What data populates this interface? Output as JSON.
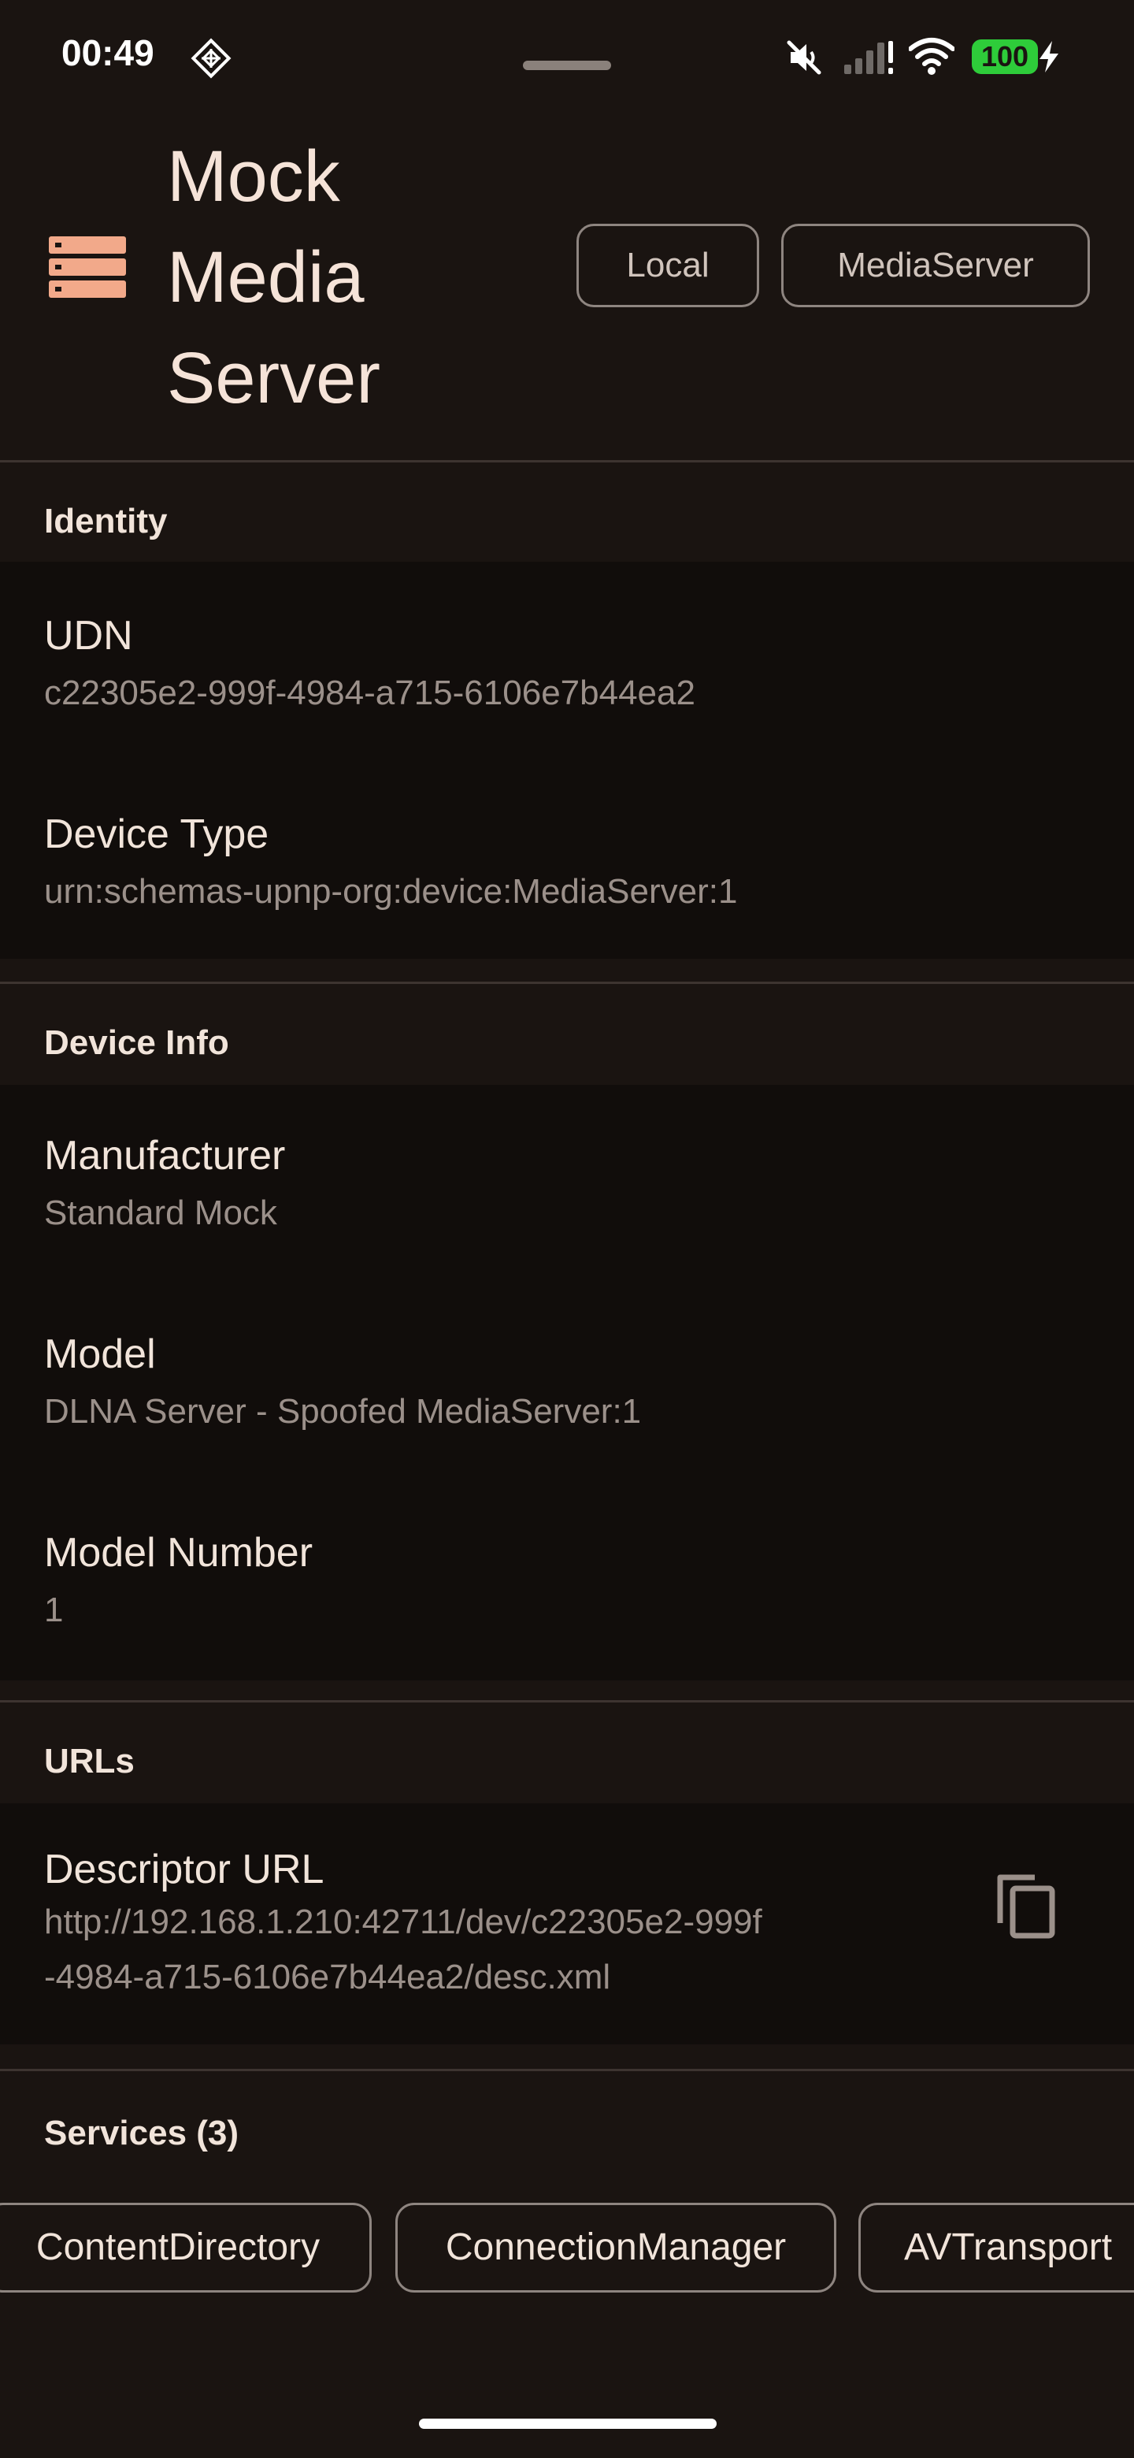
{
  "status_bar": {
    "time": "00:49",
    "battery": "100",
    "icons": [
      "app-notification-icon",
      "mute-icon",
      "signal-icon",
      "wifi-icon",
      "charging-bolt-icon"
    ],
    "battery_color": "#2ecc3a"
  },
  "header": {
    "title": "Mock Media Server",
    "title_lines": [
      "Mock",
      "Media",
      "Server"
    ],
    "icon": "server-stack-icon",
    "chips": [
      "Local",
      "MediaServer"
    ],
    "accent_color": "#f2a98a"
  },
  "sections": {
    "identity": {
      "title": "Identity",
      "rows": [
        {
          "label": "UDN",
          "value": "c22305e2-999f-4984-a715-6106e7b44ea2"
        },
        {
          "label": "Device Type",
          "value": "urn:schemas-upnp-org:device:MediaServer:1"
        }
      ]
    },
    "device_info": {
      "title": "Device Info",
      "rows": [
        {
          "label": "Manufacturer",
          "value": "Standard Mock"
        },
        {
          "label": "Model",
          "value": "DLNA Server - Spoofed MediaServer:1"
        },
        {
          "label": "Model Number",
          "value": "1"
        }
      ]
    },
    "urls": {
      "title": "URLs",
      "rows": [
        {
          "label": "Descriptor URL",
          "value": "http://192.168.1.210:42711/dev/c22305e2-999f-4984-a715-6106e7b44ea2/desc.xml",
          "value_lines": [
            "http://192.168.1.210:42711/dev/c22305e2-999f",
            "-4984-a715-6106e7b44ea2/desc.xml"
          ],
          "action_icon": "copy-icon"
        }
      ]
    },
    "services": {
      "title": "Services (3)",
      "chips": [
        "ContentDirectory",
        "ConnectionManager",
        "AVTransport"
      ]
    }
  }
}
